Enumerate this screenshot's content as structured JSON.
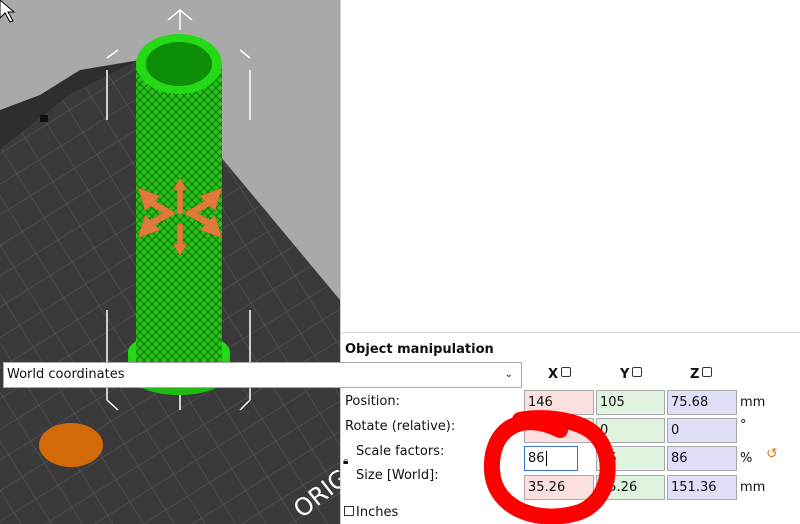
{
  "viewport": {
    "watermark": "ORIG",
    "colors": {
      "model": "#22e010",
      "handle": "#e07a3c",
      "disc": "#d26a0a",
      "bed": "#3a3a3a"
    }
  },
  "object_manipulation": {
    "title": "Object manipulation",
    "coordinate_system": "World coordinates",
    "axes": [
      "X",
      "Y",
      "Z"
    ],
    "position": {
      "label": "Position:",
      "x": "146",
      "y": "105",
      "z": "75.68",
      "unit": "mm"
    },
    "rotate": {
      "label": "Rotate (relative):",
      "x": "",
      "y": "0",
      "z": "0",
      "unit": "°"
    },
    "scale": {
      "label": "Scale factors:",
      "x": "86",
      "y": "86",
      "z": "86",
      "unit": "%"
    },
    "size": {
      "label": "Size [World]:",
      "x": "35.26",
      "y": "35.26",
      "z": "151.36",
      "unit": "mm"
    },
    "inches_label": "Inches",
    "icons": [
      "lock-icon",
      "reset-scale-icon",
      "dropdown-chevron-icon"
    ]
  }
}
